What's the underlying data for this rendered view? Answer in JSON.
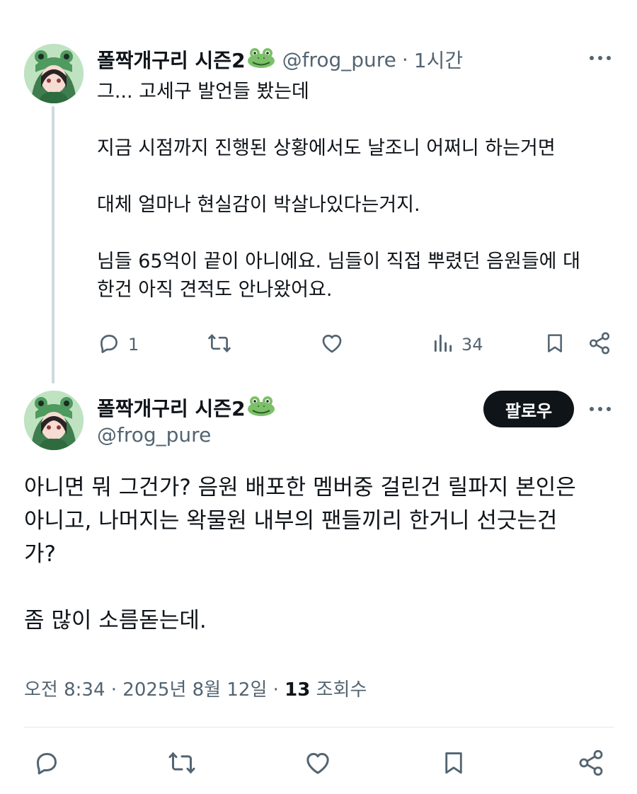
{
  "post1": {
    "display_name": "폴짝개구리 시즌2",
    "name_emoji": "frog-face-emoji",
    "handle": "@frog_pure",
    "separator": "·",
    "time": "1시간",
    "text": "그... 고세구 발언들 봤는데\n\n지금 시점까지 진행된 상황에서도 날조니 어쩌니 하는거면\n\n대체 얼마나 현실감이 박살나있다는거지.\n\n님들 65억이 끝이 아니에요. 님들이 직접 뿌렸던 음원들에 대\n한건 아직 견적도 안나왔어요.",
    "actions": {
      "reply_count": "1",
      "views_count": "34"
    }
  },
  "post2": {
    "display_name": "폴짝개구리 시즌2",
    "name_emoji": "frog-face-emoji",
    "handle": "@frog_pure",
    "follow_label": "팔로우",
    "text": "아니면 뭐 그건가? 음원 배포한 멤버중 걸린건 릴파지 본인은\n아니고, 나머지는 왁물원 내부의 팬들끼리 한거니 선긋는건\n가?\n\n좀 많이 소름돋는데.",
    "timestamp": "오전 8:34 · 2025년 8월 12일 · ",
    "views_number": "13",
    "views_label": " 조회수"
  },
  "colors": {
    "text": "#0f1419",
    "secondary": "#536471",
    "thread_line": "#cfd9de",
    "follow_bg": "#0f1419"
  },
  "icons": [
    "reply-icon",
    "retweet-icon",
    "like-icon",
    "views-icon",
    "bookmark-icon",
    "share-icon",
    "more-icon"
  ]
}
